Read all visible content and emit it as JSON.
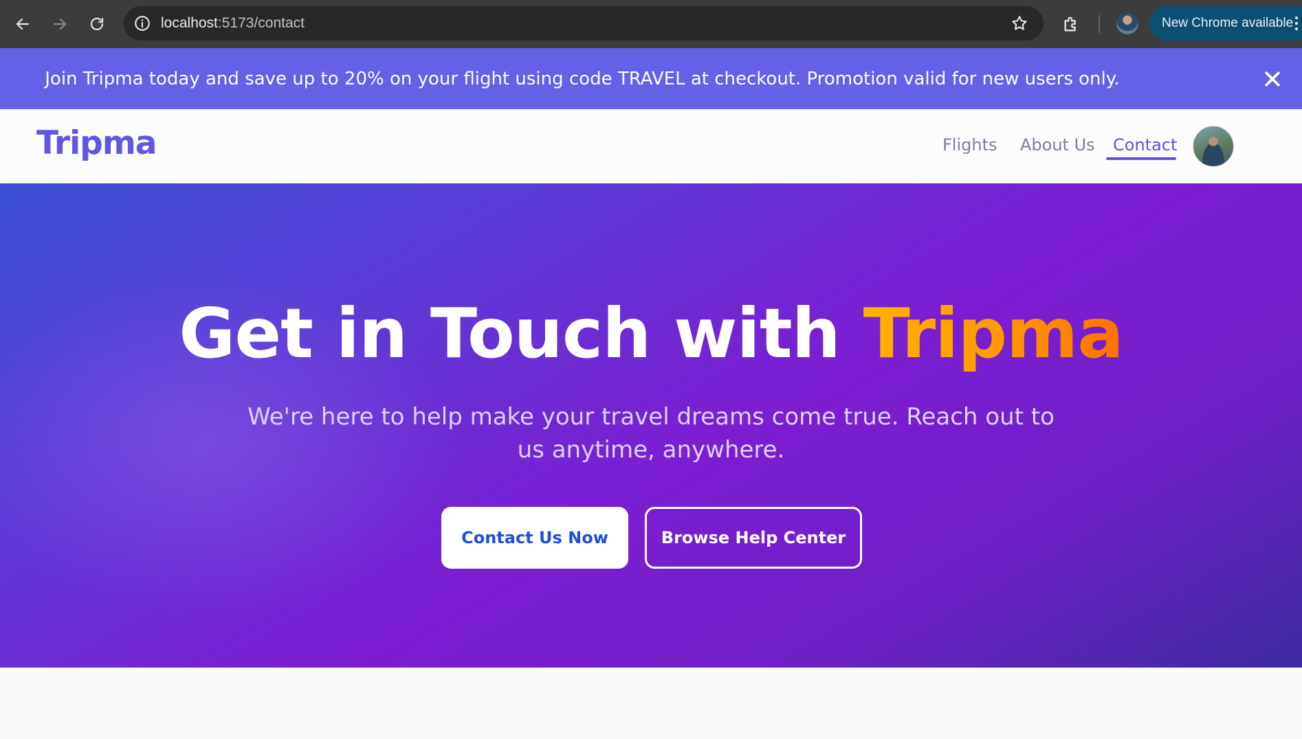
{
  "browser": {
    "url_host": "localhost",
    "url_path": ":5173/contact",
    "update_label": "New Chrome available"
  },
  "promo": {
    "text": "Join Tripma today and save up to 20% on your flight using code TRAVEL at checkout. Promotion valid for new users only."
  },
  "navbar": {
    "logo": "Tripma",
    "links": [
      {
        "label": "Flights",
        "active": false
      },
      {
        "label": "About Us",
        "active": false
      },
      {
        "label": "Contact",
        "active": true
      }
    ]
  },
  "hero": {
    "title_main": "Get in Touch with ",
    "title_accent": "Tripma",
    "subtitle": "We're here to help make your travel dreams come true. Reach out to us anytime, anywhere.",
    "primary_button": "Contact Us Now",
    "secondary_button": "Browse Help Center"
  },
  "colors": {
    "brand": "#6056e3",
    "promo_bg": "#6460e8",
    "accent_gradient": [
      "#ffb300",
      "#ff6f00"
    ],
    "primary_button_text": "#1d4fd8"
  }
}
